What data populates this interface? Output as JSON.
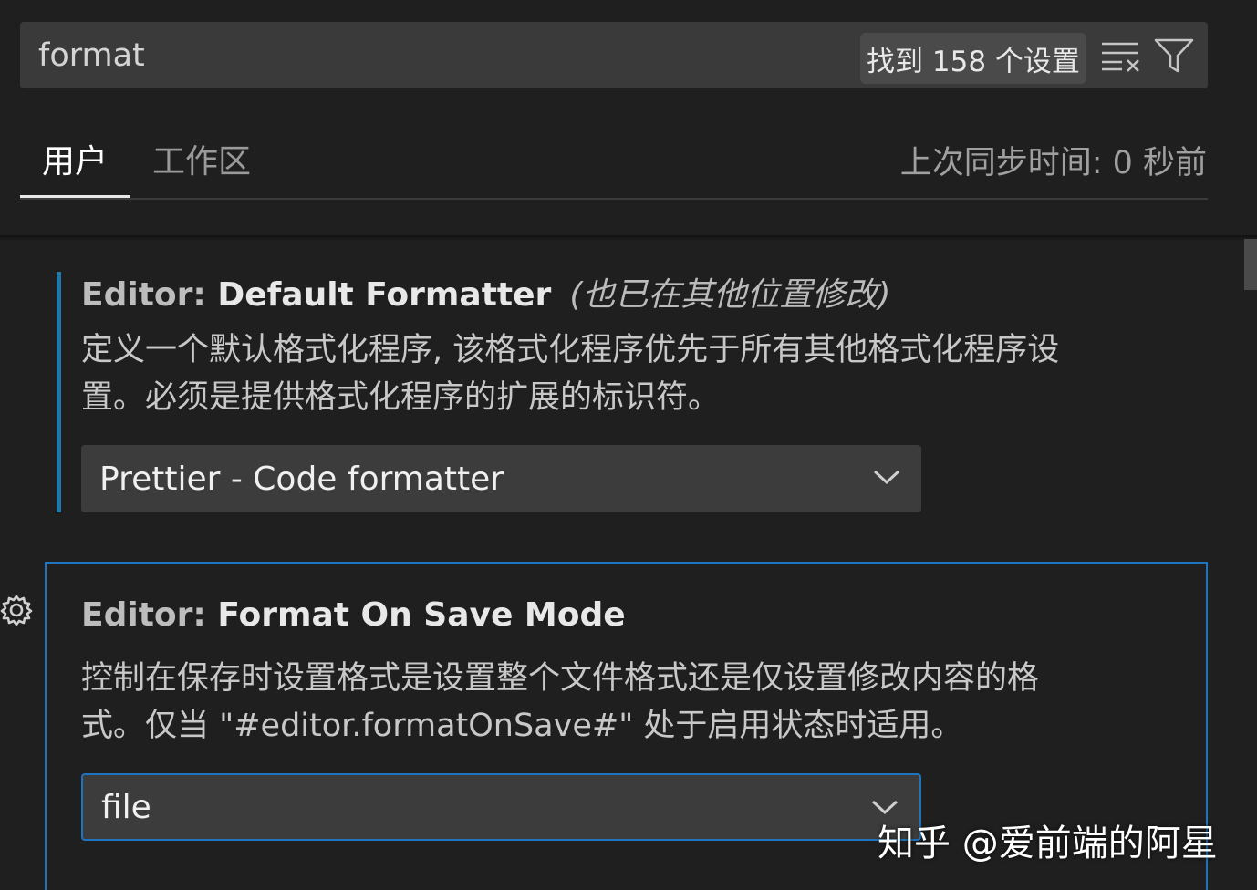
{
  "search": {
    "value": "format",
    "result_count": "找到 158 个设置"
  },
  "tabs": [
    {
      "label": "用户",
      "active": true
    },
    {
      "label": "工作区",
      "active": false
    }
  ],
  "sync_status": "上次同步时间: 0 秒前",
  "settings": [
    {
      "category": "Editor: ",
      "name": "Default Formatter",
      "modified_note": "(也已在其他位置修改)",
      "description_line1": "定义一个默认格式化程序, 该格式化程序优先于所有其他格式化程序设",
      "description_line2": "置。必须是提供格式化程序的扩展的标识符。",
      "value": "Prettier - Code formatter"
    },
    {
      "category": "Editor: ",
      "name": "Format On Save Mode",
      "description_line1": "控制在保存时设置格式是设置整个文件格式还是仅设置修改内容的格",
      "description_line2": "式。仅当 \"#editor.formatOnSave#\" 处于启用状态时适用。",
      "value": "file"
    }
  ],
  "watermark": "知乎 @爱前端的阿星",
  "icons": {
    "clear": "clear-filter-icon",
    "filter": "filter-icon",
    "gear": "gear-icon",
    "chevron": "chevron-down-icon"
  },
  "colors": {
    "accent": "#1f74bf",
    "modified_bar": "#1e79a8",
    "background": "#1f1f1f"
  }
}
